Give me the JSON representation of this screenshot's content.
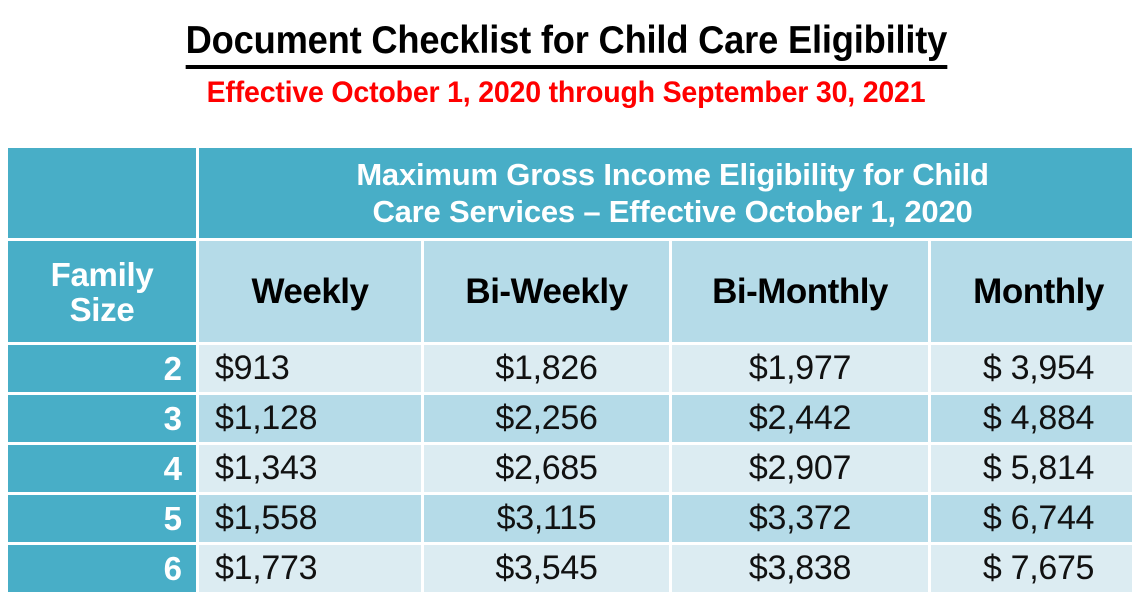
{
  "document": {
    "title": "Document Checklist for Child Care Eligibility",
    "subtitle": "Effective October 1, 2020 through September 30, 2021"
  },
  "table": {
    "banner": {
      "line1": "Maximum Gross Income Eligibility for Child",
      "line2": "Care Services – Effective October 1, 2020"
    },
    "row_header": {
      "line1": "Family",
      "line2": "Size"
    },
    "columns": [
      "Weekly",
      "Bi-Weekly",
      "Bi-Monthly",
      "Monthly"
    ],
    "rows": [
      {
        "family_size": "2",
        "weekly": "$913",
        "bi_weekly": "$1,826",
        "bi_monthly": "$1,977",
        "monthly": "$ 3,954"
      },
      {
        "family_size": "3",
        "weekly": "$1,128",
        "bi_weekly": "$2,256",
        "bi_monthly": "$2,442",
        "monthly": "$ 4,884"
      },
      {
        "family_size": "4",
        "weekly": "$1,343",
        "bi_weekly": "$2,685",
        "bi_monthly": "$2,907",
        "monthly": "$ 5,814"
      },
      {
        "family_size": "5",
        "weekly": "$1,558",
        "bi_weekly": "$3,115",
        "bi_monthly": "$3,372",
        "monthly": "$ 6,744"
      },
      {
        "family_size": "6",
        "weekly": "$1,773",
        "bi_weekly": "$3,545",
        "bi_monthly": "$3,838",
        "monthly": "$ 7,675"
      }
    ]
  },
  "colors": {
    "header_teal": "#48aec7",
    "cell_light": "#dcecf2",
    "cell_medium": "#b5dbe8",
    "subtitle_red": "#ff0000",
    "title_black": "#000000"
  }
}
